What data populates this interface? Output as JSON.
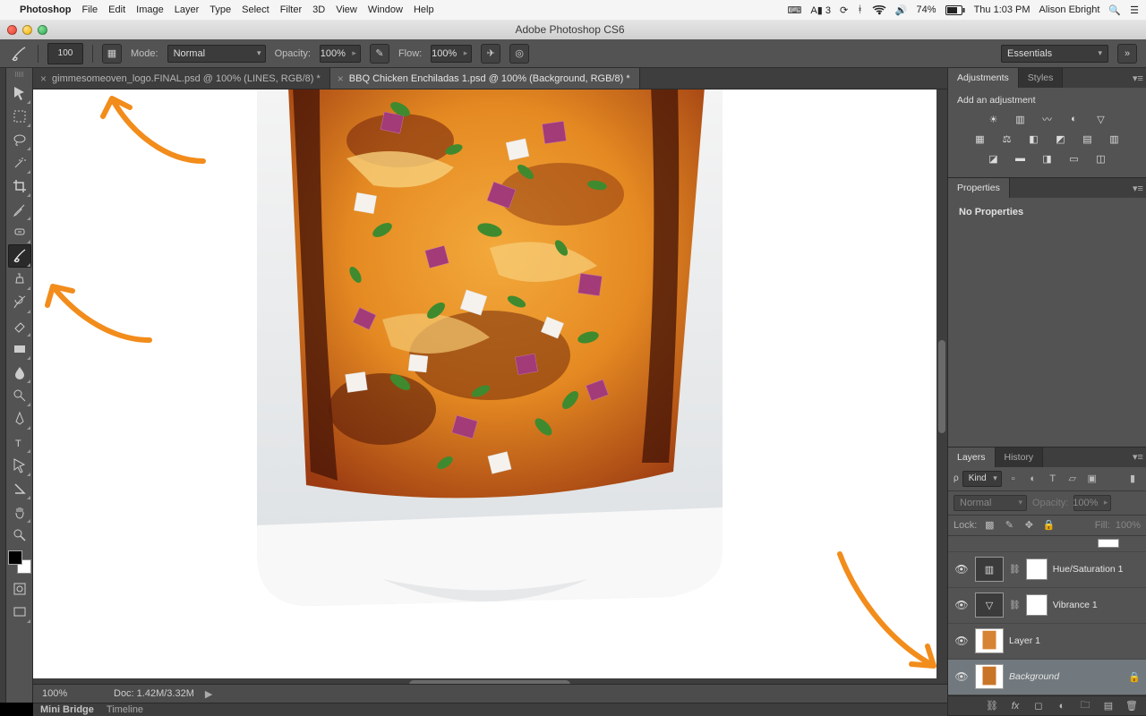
{
  "mac": {
    "apple": "",
    "app": "Photoshop",
    "menus": [
      "File",
      "Edit",
      "Image",
      "Layer",
      "Type",
      "Select",
      "Filter",
      "3D",
      "View",
      "Window",
      "Help"
    ],
    "tray": {
      "adobe": "A▮ 3",
      "battery": "74%",
      "clock": "Thu 1:03 PM",
      "user": "Alison Ebright"
    }
  },
  "titlebar": {
    "title": "Adobe Photoshop CS6"
  },
  "options": {
    "brush_size": "100",
    "mode_label": "Mode:",
    "mode_value": "Normal",
    "opacity_label": "Opacity:",
    "opacity_value": "100%",
    "flow_label": "Flow:",
    "flow_value": "100%",
    "workspace": "Essentials"
  },
  "tabs": [
    {
      "label": "gimmesomeoven_logo.FINAL.psd @ 100% (LINES, RGB/8) *",
      "active": false
    },
    {
      "label": "BBQ Chicken Enchiladas 1.psd @ 100% (Background, RGB/8) *",
      "active": true
    }
  ],
  "status": {
    "zoom": "100%",
    "doc": "Doc: 1.42M/3.32M"
  },
  "bottom": {
    "minibridge": "Mini Bridge",
    "timeline": "Timeline"
  },
  "adjustments": {
    "tab1": "Adjustments",
    "tab2": "Styles",
    "heading": "Add an adjustment"
  },
  "properties": {
    "tab": "Properties",
    "text": "No Properties"
  },
  "layers": {
    "tab1": "Layers",
    "tab2": "History",
    "kind_label": "Kind",
    "blend_label": "Normal",
    "opacity_label": "Opacity:",
    "opacity_value": "100%",
    "lock_label": "Lock:",
    "fill_label": "Fill:",
    "fill_value": "100%",
    "items": [
      {
        "name": "Hue/Saturation 1",
        "type": "adjustment"
      },
      {
        "name": "Vibrance 1",
        "type": "adjustment"
      },
      {
        "name": "Layer 1",
        "type": "pixel"
      },
      {
        "name": "Background",
        "type": "pixel",
        "locked": true,
        "selected": true
      }
    ]
  }
}
